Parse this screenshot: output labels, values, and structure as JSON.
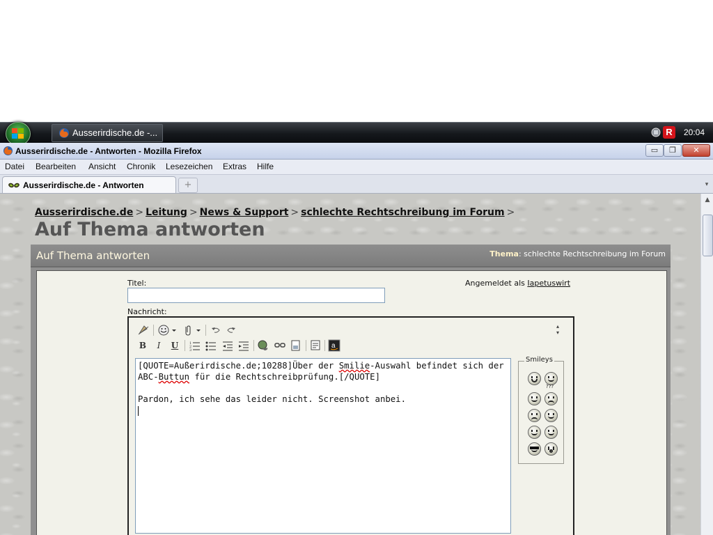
{
  "taskbar": {
    "task_label": "Ausserirdische.de -...",
    "clock": "20:04",
    "tray_badge": "R"
  },
  "window": {
    "title": "Ausserirdische.de - Antworten - Mozilla Firefox",
    "minimize": "▭",
    "maximize": "❐",
    "close": "✕"
  },
  "menu": {
    "items": [
      {
        "label": "Datei"
      },
      {
        "label": "Bearbeiten"
      },
      {
        "label": "Ansicht"
      },
      {
        "label": "Chronik"
      },
      {
        "label": "Lesezeichen"
      },
      {
        "label": "Extras"
      },
      {
        "label": "Hilfe"
      }
    ]
  },
  "tabs": {
    "active_label": "Ausserirdische.de - Antworten",
    "new_tab": "+",
    "list": "▾"
  },
  "breadcrumb": {
    "items": [
      "Ausserirdische.de",
      "Leitung",
      "News & Support",
      "schlechte Rechtschreibung im Forum"
    ],
    "separator": ">"
  },
  "page": {
    "title": "Auf Thema antworten"
  },
  "panel": {
    "title": "Auf Thema antworten",
    "topic_label": "Thema",
    "topic_value": ": schlechte Rechtschreibung im Forum"
  },
  "form": {
    "title_label": "Titel:",
    "title_value": "",
    "logged_in_prefix": "Angemeldet als",
    "username": "Iapetuswirt",
    "message_label": "Nachricht:"
  },
  "editor": {
    "toolbar": {
      "bold": "B",
      "italic": "I",
      "underline": "U"
    },
    "text": {
      "line1_a": "[QUOTE=Außerirdische.de;10288]Über der ",
      "line1_b": "Smilie",
      "line1_c": "-Auswahl befindet sich der",
      "line2_a": "ABC-",
      "line2_b": "Buttun",
      "line2_c": " für die Rechtschreibprüfung.[/QUOTE]",
      "line3": "Pardon, ich sehe das leider nicht. Screenshot anbei."
    },
    "smileys_legend": "Smileys",
    "smiley_extra_label": "???"
  },
  "colors": {
    "taskbar": "#15181c",
    "titlebar": "#c6d2ea",
    "panel_header": "#848484",
    "panel_body": "#f2f2ea",
    "panel_title_text": "#fff8e0"
  }
}
